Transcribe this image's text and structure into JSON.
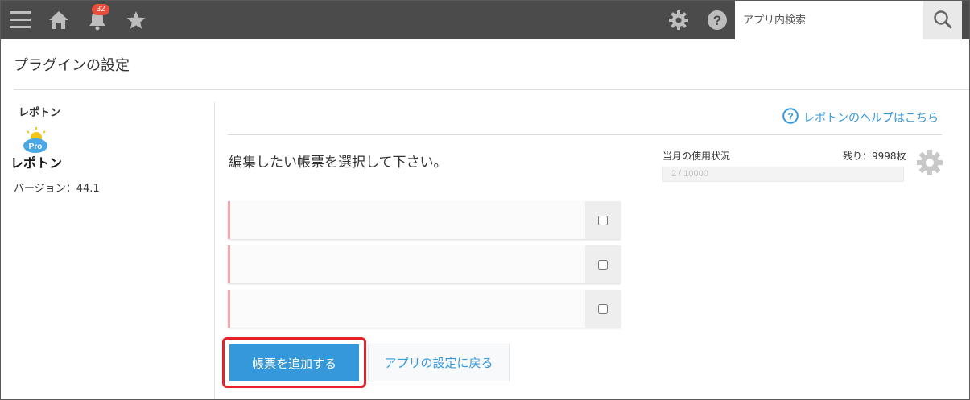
{
  "header": {
    "icons": [
      "menu-icon",
      "home-icon",
      "bell-icon",
      "star-icon",
      "gear-icon",
      "help-icon",
      "search-icon"
    ],
    "notification_count": "32",
    "search_placeholder": "アプリ内検索",
    "bar_color": "#4b4b4b"
  },
  "page": {
    "title": "プラグインの設定"
  },
  "sidebar": {
    "plugin_name": "レポトン",
    "logo_badge": "Pro",
    "logo_text": "レポトン",
    "version": "バージョン：44.1"
  },
  "main": {
    "help_link": "レポトンのヘルプはこちら",
    "instruction": "編集したい帳票を選択して下さい。",
    "usage": {
      "label": "当月の使用状況",
      "remaining": "残り：9998枚",
      "used": 2,
      "limit": 10000,
      "text": "2 / 10000"
    },
    "reports": [
      {
        "name": "",
        "checked": false
      },
      {
        "name": "",
        "checked": false
      },
      {
        "name": "",
        "checked": false
      }
    ],
    "add_button": "帳票を追加する",
    "back_button": "アプリの設定に戻る",
    "accent_color": "#3498db",
    "highlight_color": "#e6212a"
  }
}
